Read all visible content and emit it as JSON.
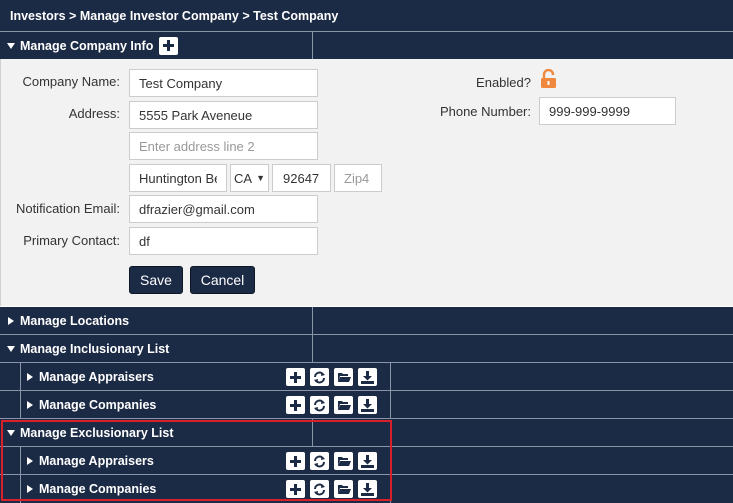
{
  "breadcrumb": "Investors > Manage Investor Company > Test Company",
  "company_info": {
    "title": "Manage Company Info",
    "labels": {
      "company_name": "Company Name:",
      "address": "Address:",
      "notification_email": "Notification Email:",
      "primary_contact": "Primary Contact:",
      "enabled": "Enabled?",
      "phone": "Phone Number:"
    },
    "values": {
      "company_name": "Test Company",
      "address1": "5555 Park Aveneue",
      "city": "Huntington Be",
      "state": "CA",
      "zip": "92647",
      "email": "dfrazier@gmail.com",
      "contact": "df",
      "phone": "999-999-9999"
    },
    "placeholders": {
      "address2": "Enter address line 2",
      "zip4": "Zip4"
    },
    "buttons": {
      "save": "Save",
      "cancel": "Cancel"
    }
  },
  "sections": {
    "locations": "Manage Locations",
    "inclusionary": "Manage Inclusionary List",
    "exclusionary": "Manage Exclusionary List",
    "appraisers": "Manage Appraisers",
    "companies": "Manage Companies"
  },
  "colors": {
    "header_bg": "#1b2a45",
    "form_bg": "#f2f2f2",
    "lock_icon": "#f0883e",
    "highlight": "#d8202a"
  }
}
